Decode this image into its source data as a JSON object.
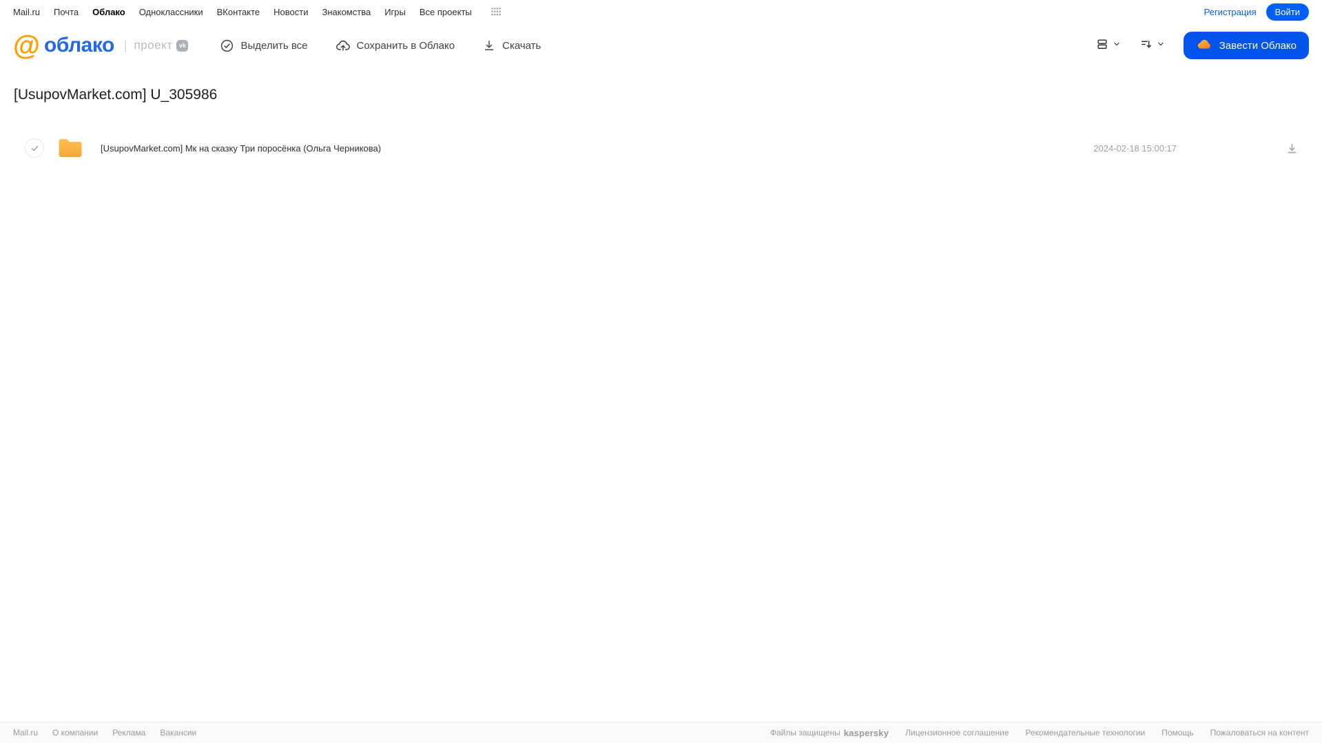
{
  "topnav": {
    "items": [
      "Mail.ru",
      "Почта",
      "Облако",
      "Одноклассники",
      "ВКонтакте",
      "Новости",
      "Знакомства",
      "Игры",
      "Все проекты"
    ],
    "active_item": "Облако",
    "registration_label": "Регистрация",
    "login_label": "Войти"
  },
  "header": {
    "logo_at": "@",
    "logo_text": "облако",
    "project_label": "проект",
    "vk_badge": "vk",
    "toolbar": {
      "select_all_label": "Выделить все",
      "save_to_cloud_label": "Сохранить в Облако",
      "download_label": "Скачать"
    },
    "get_cloud_label": "Завести Облако"
  },
  "page": {
    "title": "[UsupovMarket.com] U_305986"
  },
  "file_list": {
    "rows": [
      {
        "name": "[UsupovMarket.com] Мк на сказку Три поросёнка (Ольга Черникова)",
        "datetime": "2024-02-18 15:00:17",
        "type": "folder"
      }
    ]
  },
  "footer": {
    "left_links": [
      "Mail.ru",
      "О компании",
      "Реклама",
      "Вакансии"
    ],
    "protected_text": "Файлы защищены",
    "kaspersky_label": "kaspersky",
    "right_links": [
      "Лицензионное соглашение",
      "Рекомендательные технологии",
      "Помощь",
      "Пожаловаться на контент"
    ]
  },
  "icons": {
    "apps-grid-icon": "dots-grid-4x3",
    "select-all-icon": "check-in-circle",
    "save-to-cloud-icon": "cloud-with-up-arrow",
    "download-icon": "arrow-down-over-line",
    "view-mode-icon": "stacked-rows",
    "sort-icon": "lines-with-down-arrow",
    "chevron-down-icon": "˅",
    "cloud-logo-icon": "orange-cloud-blob",
    "folder-icon": "orange-folder",
    "check-icon": "✓"
  },
  "colors": {
    "accent_blue": "#005FF9",
    "button_blue": "#0254EC",
    "logo_blue": "#2169E8",
    "logo_orange": "#FF9E00",
    "folder_orange_top": "#FFC14F",
    "folder_orange_bottom": "#F2A63D",
    "kaspersky_green": "#00A88E",
    "footer_text": "#96999d",
    "muted_text": "#9da0a5"
  }
}
